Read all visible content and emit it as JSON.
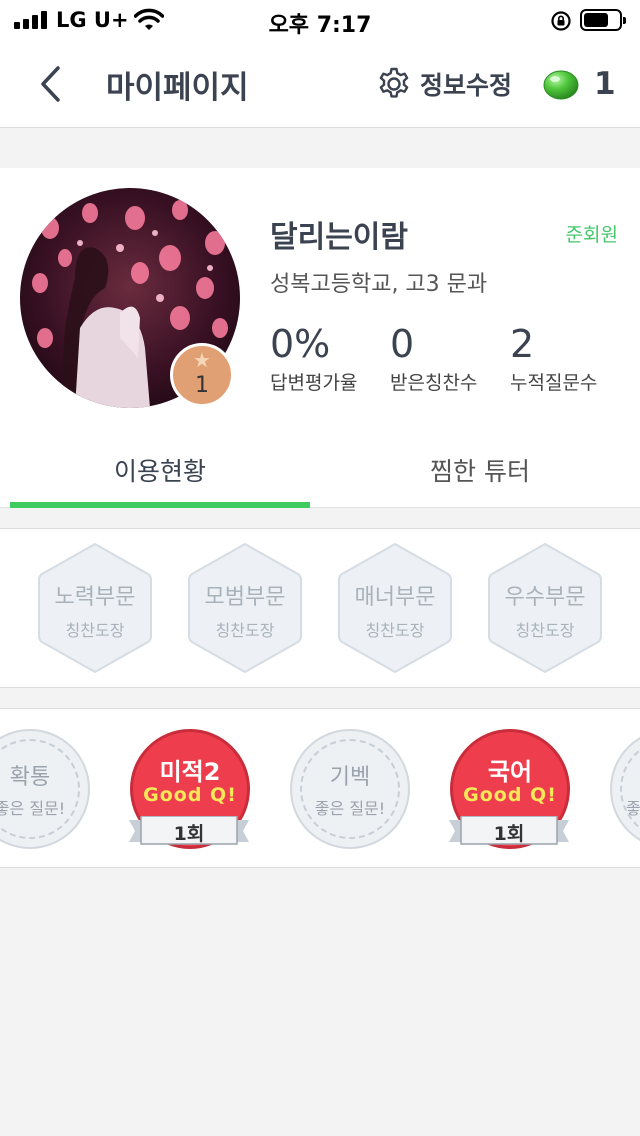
{
  "status_bar": {
    "carrier": "LG U+",
    "time": "오후 7:17"
  },
  "nav": {
    "title": "마이페이지",
    "edit_label": "정보수정",
    "points": "1"
  },
  "profile": {
    "nickname": "달리는이람",
    "grade": "준회원",
    "school": "성복고등학교, 고3 문과",
    "level": "1",
    "stats": [
      {
        "value": "0%",
        "label": "답변평가율"
      },
      {
        "value": "0",
        "label": "받은칭찬수"
      },
      {
        "value": "2",
        "label": "누적질문수"
      }
    ]
  },
  "tabs": [
    {
      "label": "이용현황",
      "active": true
    },
    {
      "label": "찜한 튜터",
      "active": false
    }
  ],
  "badges": [
    {
      "title": "노력부문",
      "subtitle": "칭찬도장"
    },
    {
      "title": "모범부문",
      "subtitle": "칭찬도장"
    },
    {
      "title": "매너부문",
      "subtitle": "칭찬도장"
    },
    {
      "title": "우수부문",
      "subtitle": "칭찬도장"
    }
  ],
  "stamps": [
    {
      "title": "확통",
      "subtitle": "좋은 질문!",
      "earned": false
    },
    {
      "title": "미적2",
      "subtitle": "Good Q!",
      "count": "1회",
      "earned": true
    },
    {
      "title": "기벡",
      "subtitle": "좋은 질문!",
      "earned": false
    },
    {
      "title": "국어",
      "subtitle": "Good Q!",
      "count": "1회",
      "earned": true
    },
    {
      "title": "",
      "subtitle": "좋",
      "earned": false
    }
  ],
  "colors": {
    "accent_green": "#3ecb5f",
    "grade_green": "#44c66b",
    "stamp_red": "#ee3e4d",
    "title_dark": "#3b4250"
  }
}
